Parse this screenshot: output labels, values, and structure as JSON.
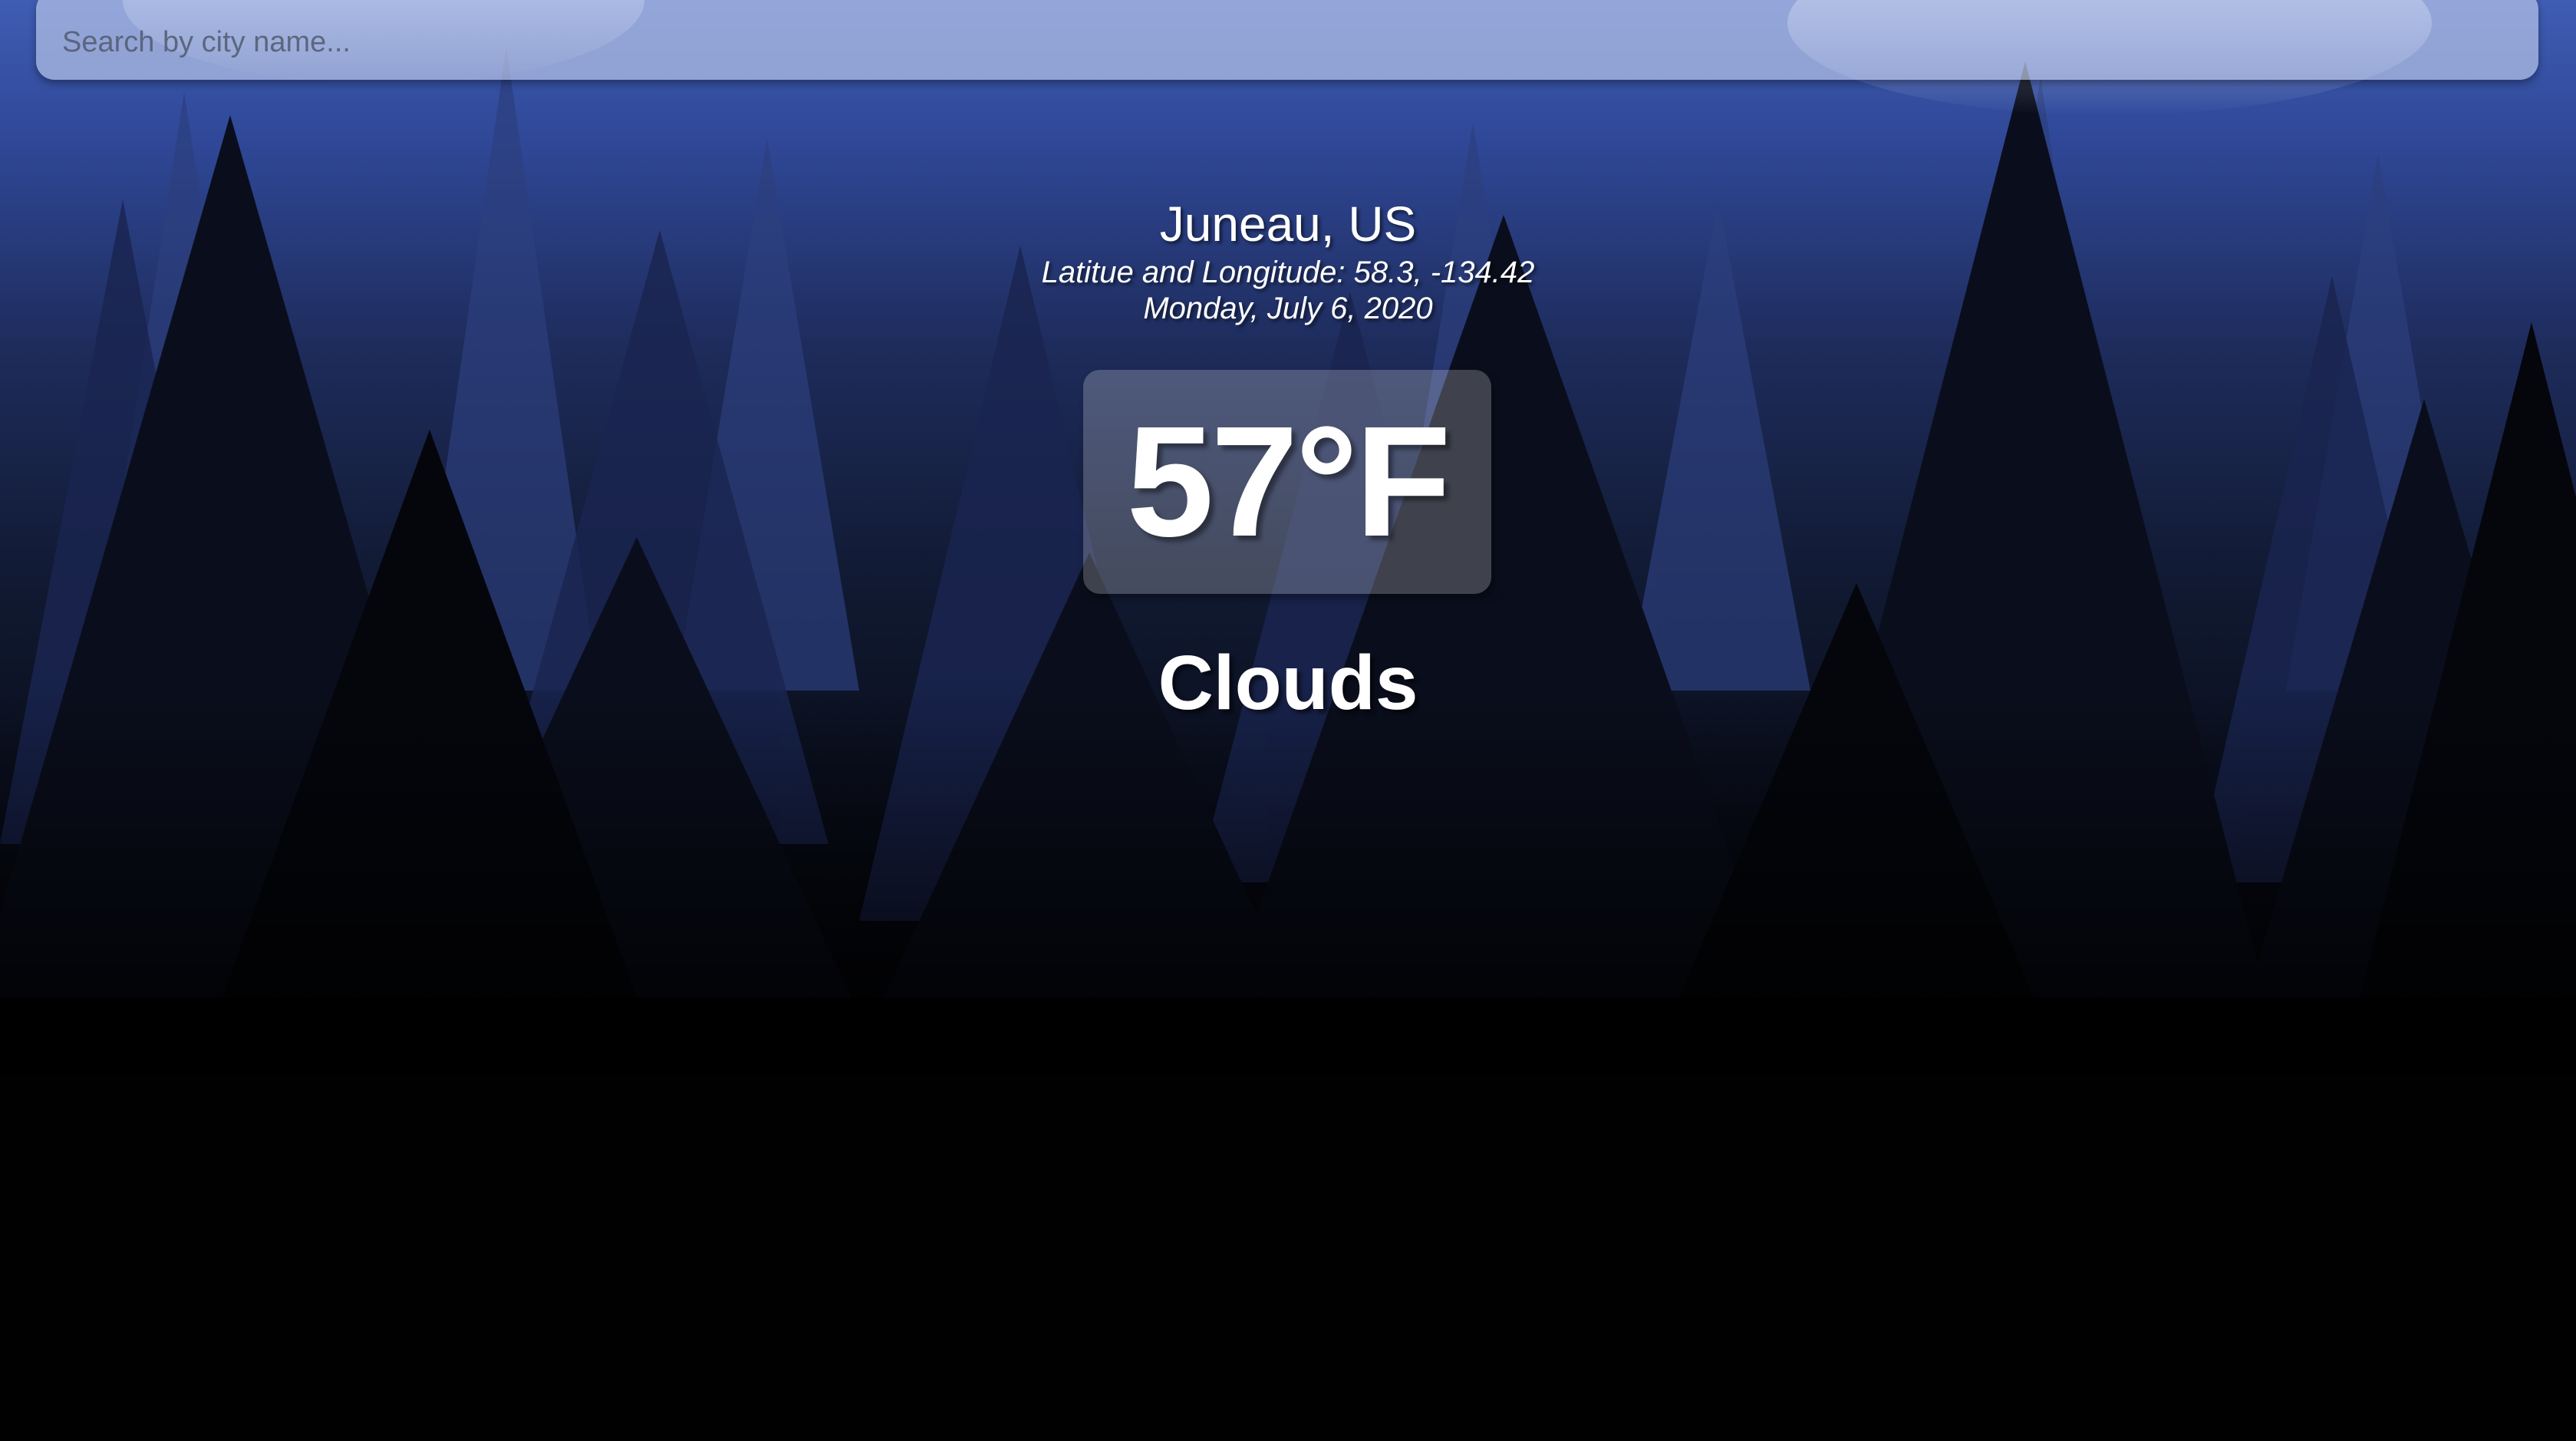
{
  "search": {
    "placeholder": "Search by city name...",
    "value": ""
  },
  "location": {
    "city": "Juneau, US",
    "coordinates": "Latitue and Longitude: 58.3, -134.42",
    "date": "Monday, July 6, 2020"
  },
  "weather": {
    "temperature": "57°F",
    "condition": "Clouds"
  },
  "colors": {
    "sky_top": "#3f5db4",
    "sky_mid": "#1e2c5c",
    "ground": "#010101",
    "text": "#ffffff"
  }
}
